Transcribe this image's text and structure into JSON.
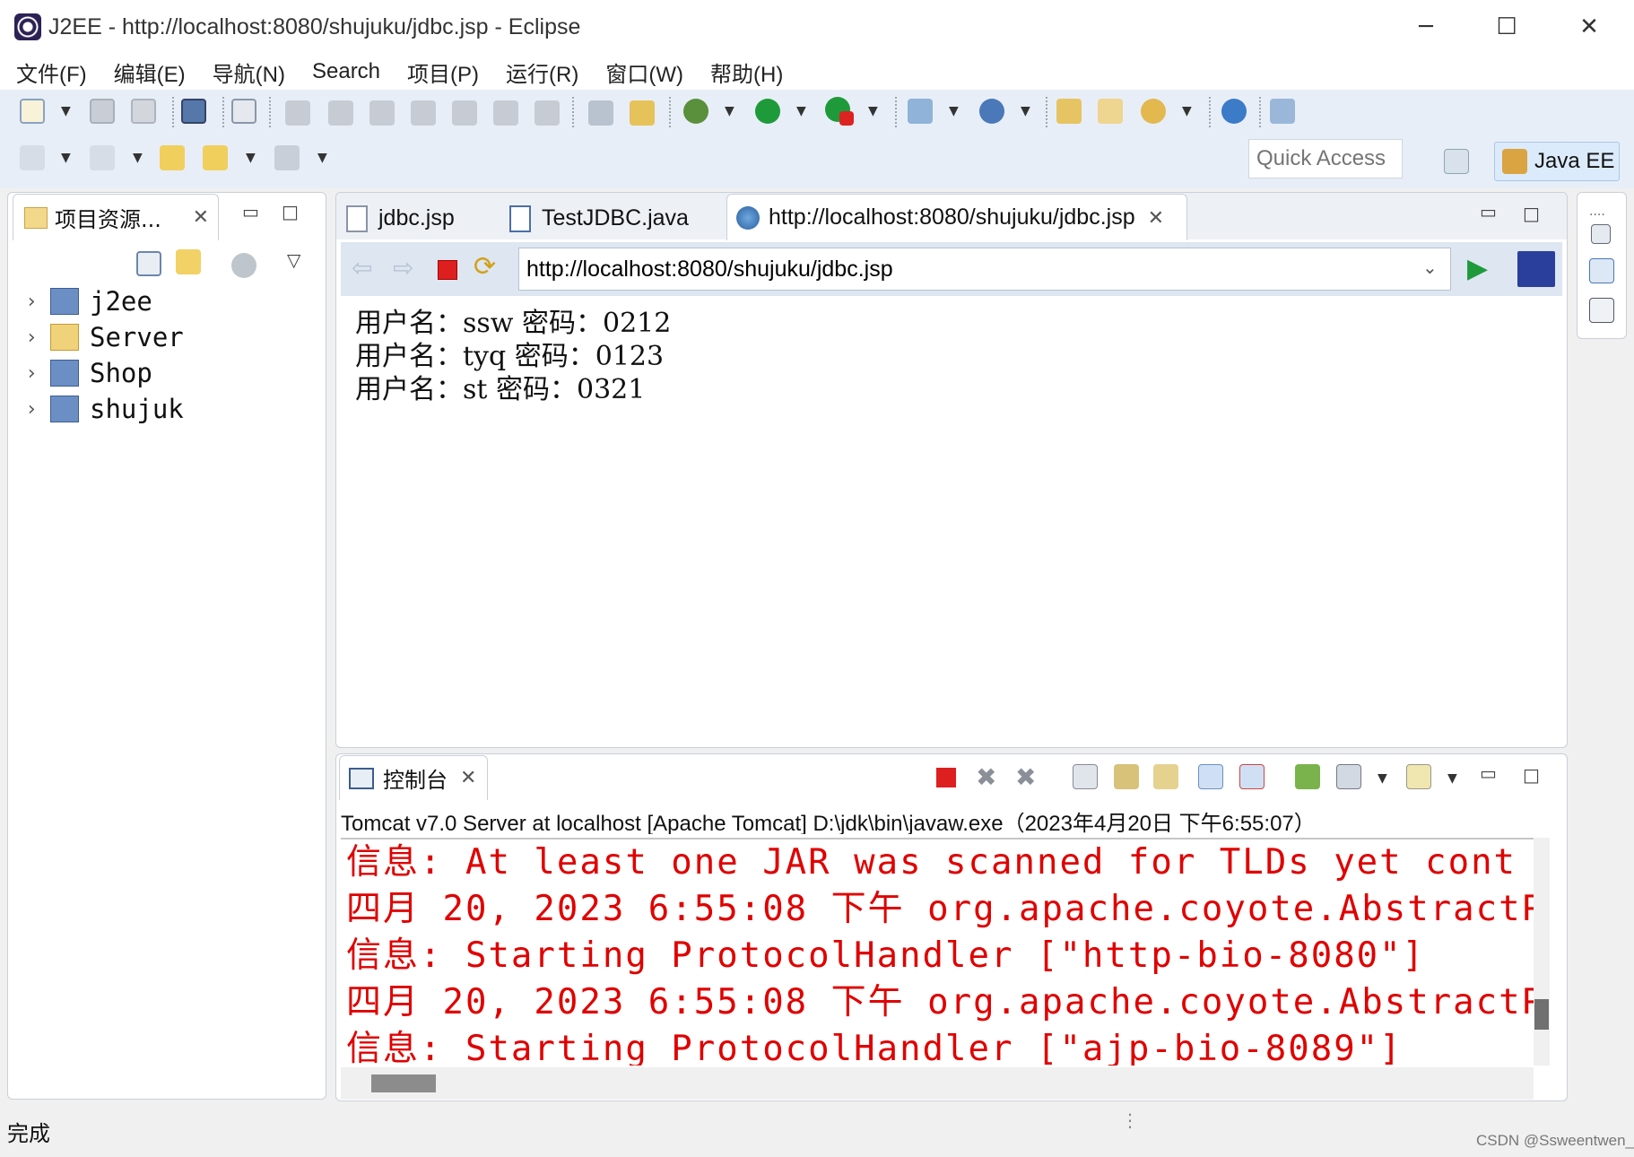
{
  "window": {
    "title": "J2EE - http://localhost:8080/shujuku/jdbc.jsp - Eclipse",
    "minimize": "─",
    "maximize": "☐",
    "close": "✕"
  },
  "menu": [
    "文件(F)",
    "编辑(E)",
    "导航(N)",
    "Search",
    "项目(P)",
    "运行(R)",
    "窗口(W)",
    "帮助(H)"
  ],
  "toolbar": {
    "quick_access_placeholder": "Quick Access",
    "perspective_label": "Java EE"
  },
  "explorer": {
    "tab_label": "项目资源...",
    "projects": [
      {
        "name": "j2ee",
        "icon": "project-error-icon"
      },
      {
        "name": "Server",
        "icon": "folder-open-icon"
      },
      {
        "name": "Shop",
        "icon": "project-warning-icon"
      },
      {
        "name": "shujuk",
        "icon": "project-warning-icon"
      }
    ]
  },
  "editor": {
    "tabs": [
      {
        "label": "jdbc.jsp",
        "icon": "jsp-file-icon"
      },
      {
        "label": "TestJDBC.java",
        "icon": "java-file-icon"
      },
      {
        "label": "http://localhost:8080/shujuku/jdbc.jsp",
        "icon": "globe-icon"
      }
    ],
    "url": "http://localhost:8080/shujuku/jdbc.jsp",
    "page_lines": [
      "用户名：ssw 密码：0212",
      "用户名：tyq 密码：0123",
      "用户名：st 密码：0321"
    ]
  },
  "console": {
    "tab_label": "控制台",
    "description": "Tomcat v7.0 Server at localhost [Apache Tomcat] D:\\jdk\\bin\\javaw.exe（2023年4月20日 下午6:55:07）",
    "lines": [
      "信息: At least one JAR was scanned for TLDs yet cont",
      "四月 20, 2023 6:55:08 下午 org.apache.coyote.AbstractP",
      "信息: Starting ProtocolHandler [\"http-bio-8080\"]",
      "四月 20, 2023 6:55:08 下午 org.apache.coyote.AbstractP",
      "信息: Starting ProtocolHandler [\"ajp-bio-8089\"]"
    ]
  },
  "status": {
    "text": "完成",
    "watermark": "CSDN @Ssweentwen_"
  },
  "colors": {
    "console_text": "#e00000",
    "toolbar_bg": "#e8eef7",
    "accent": "#2a6bd4"
  }
}
